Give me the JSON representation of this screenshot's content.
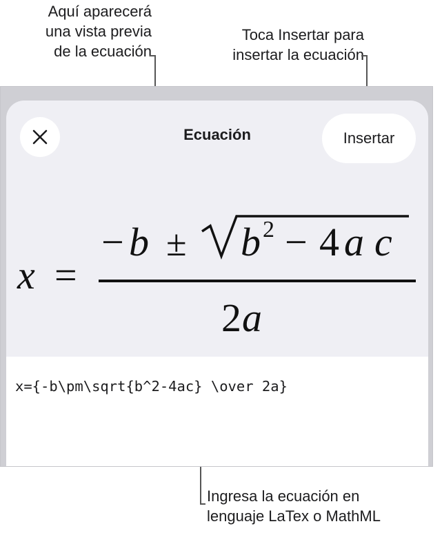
{
  "callouts": {
    "preview_line1": "Aquí aparecerá",
    "preview_line2": "una vista previa",
    "preview_line3": "de la ecuación",
    "insert_line1": "Toca Insertar para",
    "insert_line2": "insertar la ecuación",
    "input_line1": "Ingresa la ecuación en",
    "input_line2": "lenguaje LaTex o MathML"
  },
  "sheet": {
    "title": "Ecuación",
    "insert_label": "Insertar",
    "close_icon": "close-icon"
  },
  "equation": {
    "lhs": "x",
    "equals": "=",
    "minus": "−",
    "b": "b",
    "pm": "±",
    "b2_base": "b",
    "b2_exp": "2",
    "minus2": "−",
    "four": "4",
    "a": "a",
    "c": "c",
    "denominator_num": "2",
    "denominator_var": "a"
  },
  "input": {
    "value": "x={-b\\pm\\sqrt{b^2-4ac} \\over 2a}"
  },
  "colors": {
    "sheet_bg": "#efeff4",
    "frame_bg": "#cfcfd4",
    "button_bg": "#ffffff",
    "text": "#1c1c1e"
  }
}
